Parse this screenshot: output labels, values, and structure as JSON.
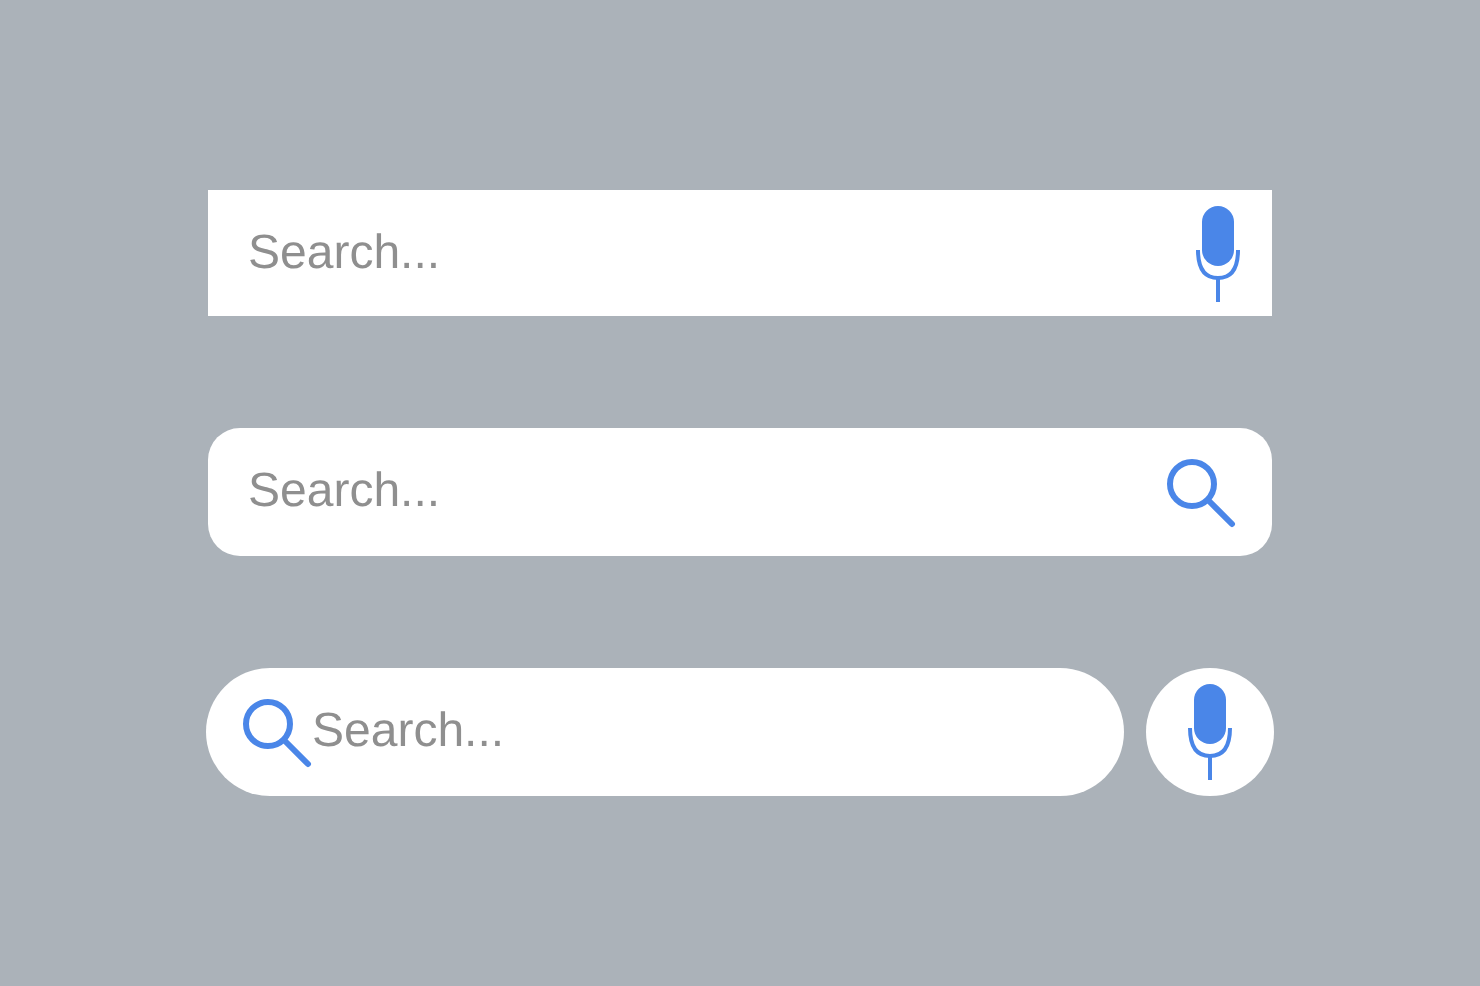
{
  "search_bars": [
    {
      "kind": "square-mic",
      "placeholder": "Search..."
    },
    {
      "kind": "rounded-search",
      "placeholder": "Search..."
    },
    {
      "kind": "pill-mic-button",
      "placeholder": "Search..."
    }
  ]
}
